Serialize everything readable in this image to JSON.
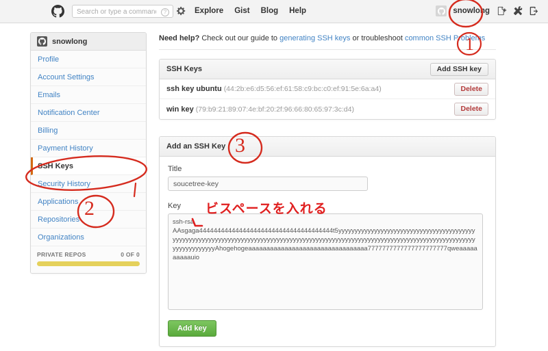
{
  "header": {
    "logo_icon": "github-mark-icon",
    "search": {
      "placeholder": "Search or type a command",
      "value": "",
      "help_icon": "question-circle-icon"
    },
    "gear_icon": "gear-icon",
    "nav": [
      {
        "label": "Explore"
      },
      {
        "label": "Gist"
      },
      {
        "label": "Blog"
      },
      {
        "label": "Help"
      }
    ],
    "user": {
      "name": "snowlong",
      "avatar_icon": "avatar-icon"
    },
    "actions": [
      {
        "name": "create-new-repo-icon"
      },
      {
        "name": "account-settings-tools-icon"
      },
      {
        "name": "sign-out-icon"
      }
    ]
  },
  "sidebar": {
    "user": "snowlong",
    "avatar_icon": "avatar-icon",
    "items": [
      {
        "label": "Profile",
        "active": false
      },
      {
        "label": "Account Settings",
        "active": false
      },
      {
        "label": "Emails",
        "active": false
      },
      {
        "label": "Notification Center",
        "active": false
      },
      {
        "label": "Billing",
        "active": false
      },
      {
        "label": "Payment History",
        "active": false
      },
      {
        "label": "SSH Keys",
        "active": true
      },
      {
        "label": "Security History",
        "active": false
      },
      {
        "label": "Applications",
        "active": false
      },
      {
        "label": "Repositories",
        "active": false
      },
      {
        "label": "Organizations",
        "active": false
      }
    ],
    "footer": {
      "label": "PRIVATE REPOS",
      "count": "0 OF 0",
      "meter_color": "#e5d15c",
      "meter_percent": 100
    }
  },
  "help_banner": {
    "strong": "Need help?",
    "text_1": " Check out our guide to ",
    "link_1": "generating SSH keys",
    "text_2": " or troubleshoot ",
    "link_2": "common SSH Problems",
    "link_color": "#4183c4"
  },
  "ssh_keys_panel": {
    "title": "SSH Keys",
    "add_button": "Add SSH key",
    "keys": [
      {
        "name": "ssh key ubuntu",
        "fingerprint": "(44:2b:e6:d5:56:ef:61:58:c9:bc:c0:ef:91:5e:6a:a4)",
        "delete_label": "Delete"
      },
      {
        "name": "win key",
        "fingerprint": "(79:b9:21:89:07:4e:bf:20:2f:96:66:80:65:97:3c:d4)",
        "delete_label": "Delete"
      }
    ]
  },
  "add_key_panel": {
    "title": "Add an SSH Key",
    "title_label": "Title",
    "title_value": "soucetree-key",
    "title_placeholder": "",
    "key_label": "Key",
    "key_value": "ssh-rsa\nAAsgaga4444444444444444444444444444444444444t5yyyyyyyyyyyyyyyyyyyyyyyyyyyyyyyyyyyyyyyyyyyyyyyyyyyyyyyyyyyyyyyyyyyyyyyyyyyyyyyyyyyyyyyyyyyyyyyyyyyyyyyyyyyyyyyyyyyyyyyyyyyyyyyyyyyyyyyyyyyyyyyyyyyyAhogehogeaaaaaaaaaaaaaaaaaaaaaaaaaaaaaaaaa7777777777777777777777qweaaaaaaaaaauio",
    "key_placeholder": "",
    "submit_label": "Add key",
    "submit_color": "#6cc644"
  },
  "annotations": {
    "color": "#d52b1e",
    "marks": [
      {
        "name": "annotation-circle-toolbar",
        "type": "circle"
      },
      {
        "name": "annotation-number-1",
        "type": "number",
        "text": "1"
      },
      {
        "name": "annotation-number-2",
        "type": "number",
        "text": "2"
      },
      {
        "name": "annotation-number-3",
        "type": "number",
        "text": "3"
      },
      {
        "name": "annotation-circle-ssh-keys",
        "type": "oval"
      },
      {
        "name": "annotation-japanese-note",
        "type": "text",
        "text": "ビスペースを入れる"
      },
      {
        "name": "annotation-arrow-space",
        "type": "arrow"
      }
    ]
  }
}
